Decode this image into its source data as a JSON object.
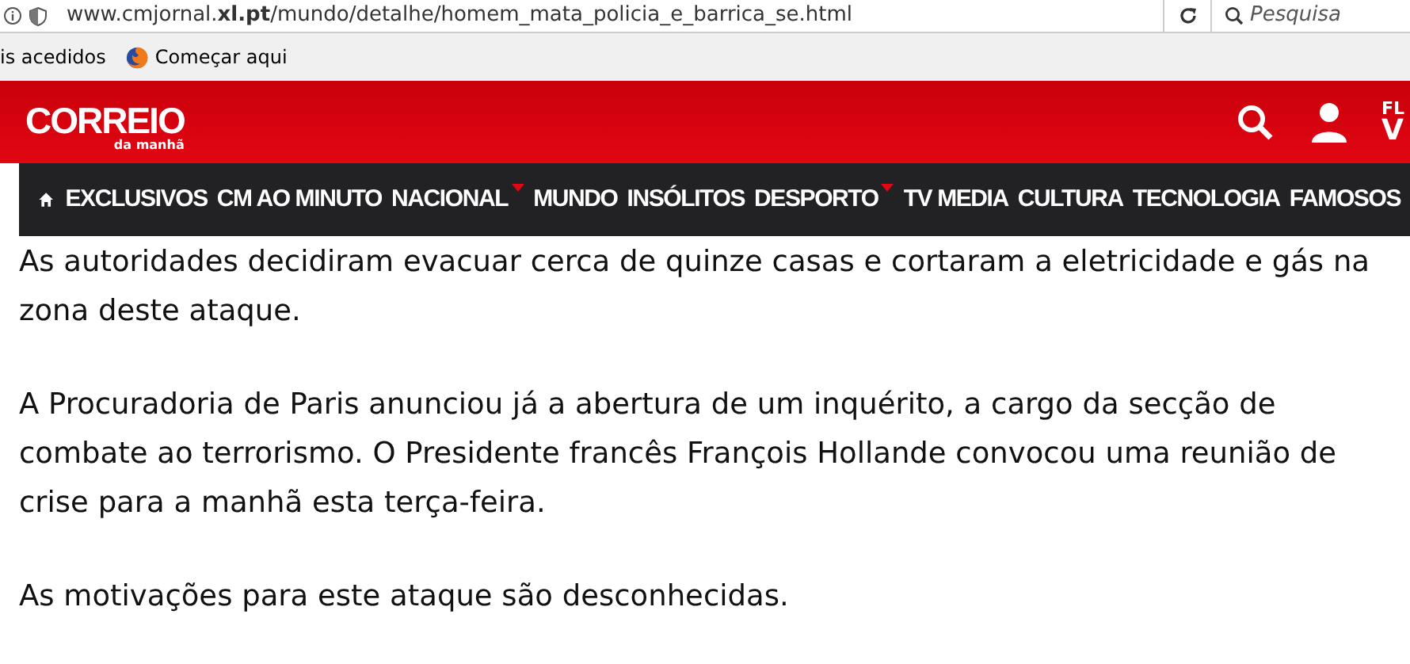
{
  "browser": {
    "url_host": "www.cmjornal.",
    "url_domain": "xl.pt",
    "url_path": "/mundo/detalhe/homem_mata_policia_e_barrica_se.html",
    "search_placeholder": "Pesquisa"
  },
  "bookmarks": [
    {
      "label": "is acedidos",
      "kind": "plain"
    },
    {
      "label": "Começar aqui",
      "kind": "firefox"
    }
  ],
  "header": {
    "logo": "CORREIO",
    "logo_sub": "da manhã",
    "cut_top": "FL",
    "cut_bottom": "V"
  },
  "nav": [
    {
      "label": "EXCLUSIVOS",
      "dropdown": false
    },
    {
      "label": "CM AO MINUTO",
      "dropdown": false
    },
    {
      "label": "NACIONAL",
      "dropdown": true
    },
    {
      "label": "MUNDO",
      "dropdown": false
    },
    {
      "label": "INSÓLITOS",
      "dropdown": false
    },
    {
      "label": "DESPORTO",
      "dropdown": true
    },
    {
      "label": "TV MEDIA",
      "dropdown": false
    },
    {
      "label": "CULTURA",
      "dropdown": false
    },
    {
      "label": "TECNOLOGIA",
      "dropdown": false
    },
    {
      "label": "FAMOSOS",
      "dropdown": false
    }
  ],
  "article": [
    "As autoridades decidiram evacuar cerca de quinze casas e cortaram a eletricidade e gás na zona deste ataque.",
    "A Procuradoria de Paris anunciou já a abertura de um inquérito, a cargo da secção de combate ao terrorismo. O Presidente francês François Hollande convocou uma reunião de crise para a manhã esta terça-feira.",
    "As motivações para este ataque são desconhecidas."
  ]
}
